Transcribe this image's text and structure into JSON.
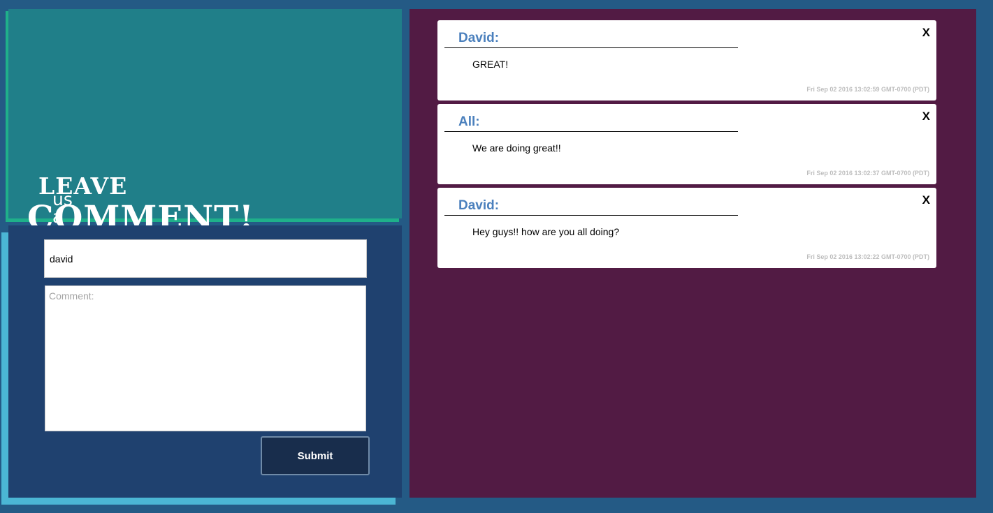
{
  "hero": {
    "leave": "LEAVE",
    "us_a": "us a",
    "comment": "COMMENT!"
  },
  "form": {
    "name_value": "david",
    "comment_placeholder": "Comment:",
    "submit_label": "Submit"
  },
  "comments": [
    {
      "author": "David:",
      "text": "GREAT!",
      "close": "X",
      "timestamp": "Fri Sep 02 2016 13:02:59 GMT-0700 (PDT)"
    },
    {
      "author": "All:",
      "text": "We are doing great!!",
      "close": "X",
      "timestamp": "Fri Sep 02 2016 13:02:37 GMT-0700 (PDT)"
    },
    {
      "author": "David:",
      "text": "Hey guys!! how are you all doing?",
      "close": "X",
      "timestamp": "Fri Sep 02 2016 13:02:22 GMT-0700 (PDT)"
    }
  ],
  "colors": {
    "page_bg": "#245a85",
    "hero_bg": "#207f89",
    "form_bg": "#1f416f",
    "comments_bg": "#521b44",
    "author": "#4b80bd"
  }
}
